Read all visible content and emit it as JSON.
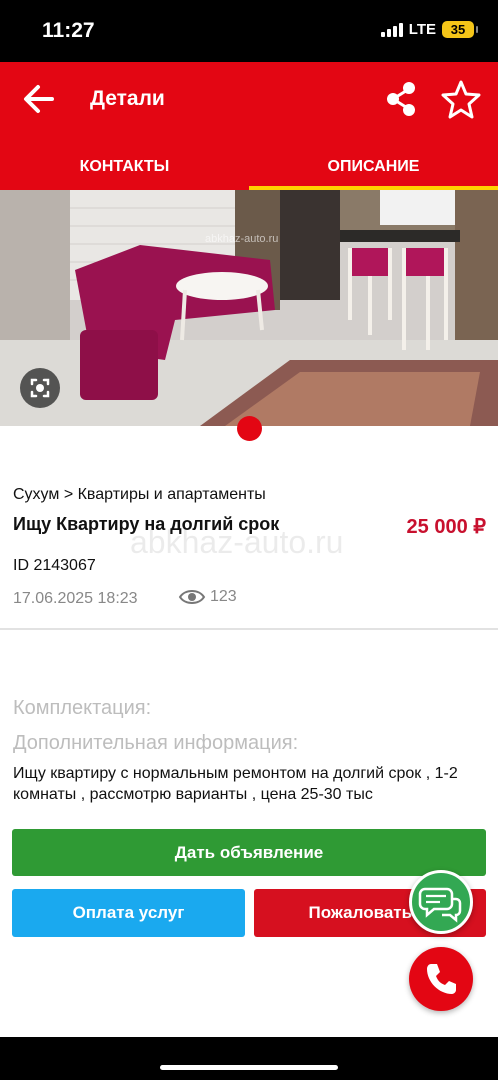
{
  "status_bar": {
    "time": "11:27",
    "network": "LTE",
    "battery": "35"
  },
  "header": {
    "title": "Детали",
    "back_icon": "arrow-left-icon",
    "share_icon": "share-icon",
    "favorite_icon": "star-outline-icon",
    "tabs": [
      {
        "label": "КОНТАКТЫ",
        "active": false
      },
      {
        "label": "ОПИСАНИЕ",
        "active": true
      }
    ]
  },
  "gallery": {
    "watermark": "abkhaz-auto.ru",
    "lens_icon": "image-search-icon",
    "page_dots": 1
  },
  "listing": {
    "breadcrumb": "Сухум > Квартиры и апартаменты",
    "title": "Ищу Квартиру на долгий срок",
    "price": "25 000 ₽",
    "watermark": "abkhaz-auto.ru",
    "id": "ID 2143067",
    "date": "17.06.2025 18:23",
    "views": "123",
    "views_icon": "eye-icon"
  },
  "details": {
    "equipment_label": "Комплектация:",
    "extra_label": "Дополнительная информация:",
    "description": "Ищу квартиру с нормальным ремонтом на долгий срок , 1-2 комнаты , рассмотрю варианты , цена 25-30 тыс"
  },
  "actions": {
    "post_ad": "Дать объявление",
    "pay_services": "Оплата услуг",
    "report": "Пожаловаться"
  },
  "fabs": {
    "chat_icon": "chat-bubbles-icon",
    "call_icon": "phone-icon"
  },
  "colors": {
    "brand_red": "#e30613",
    "tab_indicator": "#ffd200",
    "price": "#c8102e",
    "green_button": "#2f9a34",
    "blue_button": "#1aa9ef",
    "red_button": "#d6101f"
  }
}
